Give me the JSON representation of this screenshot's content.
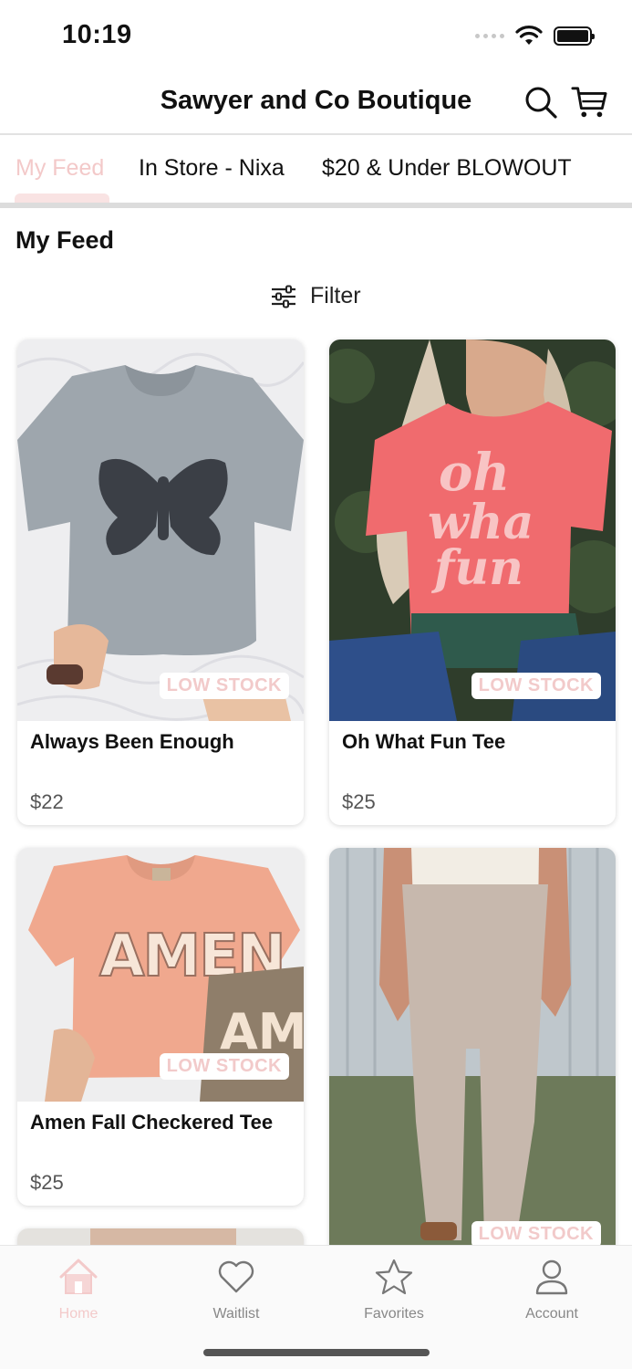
{
  "status": {
    "time": "10:19"
  },
  "header": {
    "title": "Sawyer and Co Boutique",
    "search_icon": "search-icon",
    "cart_icon": "cart-icon"
  },
  "tabs": [
    {
      "label": "My Feed",
      "active": true
    },
    {
      "label": "In Store - Nixa",
      "active": false
    },
    {
      "label": "$20 & Under BLOWOUT",
      "active": false
    }
  ],
  "feed": {
    "title": "My Feed",
    "filter_label": "Filter"
  },
  "products": [
    {
      "name": "Always Been Enough",
      "price": "$22",
      "badge": "LOW STOCK",
      "image": "gray butterfly graphic tee"
    },
    {
      "name": "Oh What Fun Tee",
      "price": "$25",
      "badge": "LOW STOCK",
      "image": "coral oh what fun tee"
    },
    {
      "name": "Amen Fall Checkered Tee",
      "price": "$25",
      "badge": "LOW STOCK",
      "image": "peach amen tee"
    },
    {
      "name": "",
      "price": "",
      "badge": "LOW STOCK",
      "image": "taupe flare leggings"
    }
  ],
  "bottom_nav": [
    {
      "label": "Home",
      "icon": "home-icon",
      "active": true
    },
    {
      "label": "Waitlist",
      "icon": "heart-icon",
      "active": false
    },
    {
      "label": "Favorites",
      "icon": "star-icon",
      "active": false
    },
    {
      "label": "Account",
      "icon": "account-icon",
      "active": false
    }
  ],
  "colors": {
    "accent_pink": "#f3c9c9",
    "text": "#111111",
    "muted": "#888888"
  }
}
